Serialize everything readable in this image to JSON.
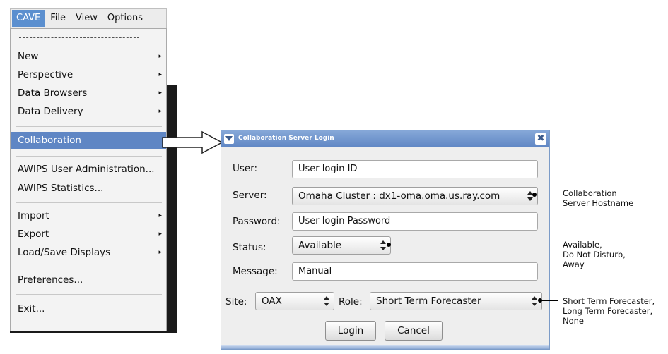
{
  "menubar": {
    "items": [
      "CAVE",
      "File",
      "View",
      "Options"
    ],
    "active": "CAVE"
  },
  "menu": {
    "items": [
      {
        "label": "New",
        "submenu": true
      },
      {
        "label": "Perspective",
        "submenu": true
      },
      {
        "label": "Data Browsers",
        "submenu": true
      },
      {
        "label": "Data Delivery",
        "submenu": true
      },
      {
        "label": "Collaboration",
        "submenu": false,
        "highlighted": true
      },
      {
        "label": "AWIPS User Administration...",
        "submenu": false
      },
      {
        "label": "AWIPS Statistics...",
        "submenu": false
      },
      {
        "label": "Import",
        "submenu": true
      },
      {
        "label": "Export",
        "submenu": true
      },
      {
        "label": "Load/Save Displays",
        "submenu": true
      },
      {
        "label": "Preferences...",
        "submenu": false
      },
      {
        "label": "Exit...",
        "submenu": false
      }
    ],
    "submenu_glyph": "▸"
  },
  "dialog": {
    "title": "Collaboration Server Login",
    "close_glyph": "✖",
    "user_label": "User:",
    "user_value": "User login ID",
    "server_label": "Server:",
    "server_value": "Omaha Cluster : dx1-oma.oma.us.ray.com",
    "password_label": "Password:",
    "password_value": "User login Password",
    "status_label": "Status:",
    "status_value": "Available",
    "message_label": "Message:",
    "message_value": "Manual",
    "site_label": "Site:",
    "site_value": "OAX",
    "role_label": "Role:",
    "role_value": "Short Term Forecaster",
    "login_button": "Login",
    "cancel_button": "Cancel"
  },
  "annotations": {
    "server": [
      "Collaboration",
      "Server Hostname"
    ],
    "status": [
      "Available,",
      "Do Not Disturb,",
      "Away"
    ],
    "role": [
      "Short Term Forecaster,",
      "Long Term Forecaster,",
      "None"
    ]
  },
  "colors": {
    "menu_highlight": "#5f86c4",
    "titlebar": "#6b90c8",
    "background": "#ffffff"
  }
}
